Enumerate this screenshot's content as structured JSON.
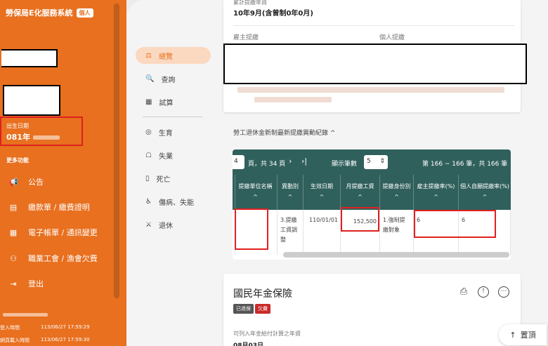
{
  "app": {
    "title": "勞保局E化服務系統",
    "badge": "個人"
  },
  "profile": {
    "birth_label": "出生日期",
    "birth_value": "081年"
  },
  "sidebar": {
    "more_title": "更多功能",
    "items": [
      {
        "label": "公告",
        "icon": "megaphone-icon"
      },
      {
        "label": "繳款單 / 繳費證明",
        "icon": "bill-icon"
      },
      {
        "label": "電子帳單 / 通訊變更",
        "icon": "ebill-icon"
      },
      {
        "label": "職業工會 / 漁會欠費",
        "icon": "union-icon"
      },
      {
        "label": "登出",
        "icon": "logout-icon"
      }
    ],
    "login": [
      {
        "label": "登入時間",
        "value": "113/06/27 17:59:29"
      },
      {
        "label": "網頁載入時間",
        "value": "113/06/27 17:59:30"
      }
    ]
  },
  "subnav": {
    "items": [
      {
        "label": "總覽",
        "icon": "overview-icon",
        "active": true
      },
      {
        "label": "查詢",
        "icon": "search-icon"
      },
      {
        "label": "試算",
        "icon": "calculator-icon"
      },
      {
        "label": "生育",
        "icon": "birth-icon"
      },
      {
        "label": "失業",
        "icon": "unemployment-icon"
      },
      {
        "label": "死亡",
        "icon": "death-icon"
      },
      {
        "label": "傷病、失能",
        "icon": "injury-icon"
      },
      {
        "label": "退休",
        "icon": "retire-icon"
      }
    ]
  },
  "top_card": {
    "period_label": "累計提繳年資",
    "period_value": "10年9月(含曾制0年0月)",
    "employer_label": "雇主提繳",
    "personal_label": "個人提繳"
  },
  "records": {
    "title": "勞工退休金新制最新提繳異動紀錄",
    "pager": {
      "page_input": "4",
      "page_text": "頁，共 34 頁",
      "per_page_label": "顯示筆數",
      "per_page_value": "5",
      "range_text": "第 166 ~ 166 筆，共 166 筆"
    },
    "columns": [
      "提繳單位名稱",
      "異動別",
      "生效日期",
      "月提繳工資",
      "提繳身份別",
      "雇主提繳率(%)",
      "個人自願提繳率(%)"
    ],
    "row": {
      "unit": "",
      "change": "3.提繳工資調整",
      "effective": "110/01/01",
      "wage": "152,500",
      "identity": "1.強制提繳對象",
      "employer_rate": "6",
      "personal_rate": "6"
    }
  },
  "national_pension": {
    "title": "國民年金保險",
    "tags": [
      "已退保",
      "欠費"
    ],
    "sub_label": "可列入年金給付計算之年資",
    "sub_value": "08月03日"
  },
  "back_to_top": "置頂",
  "colors": {
    "accent": "#e8701f",
    "table_header": "#30605c",
    "red_mark": "#e02020"
  }
}
